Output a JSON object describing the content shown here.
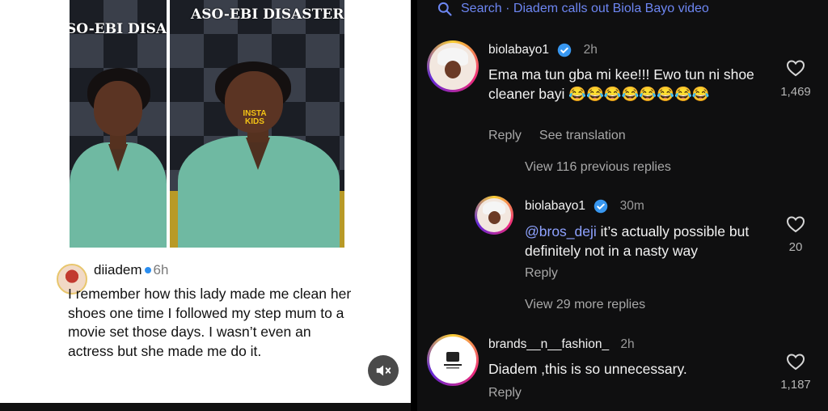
{
  "left_panel": {
    "frame1_title": "SO-EBI DISAS",
    "frame2_title": "ASO-EBI DISASTER",
    "sticker_text": "INSTA KIDS",
    "caption": {
      "username": "diiadem",
      "time": "6h",
      "text": "I remember how this lady made me clean her shoes one time I followed my step mum to a movie set those days. I wasn’t even an actress but she made me do it."
    },
    "mute_icon": "speaker-muted-icon"
  },
  "right_panel": {
    "search": {
      "icon": "search-icon",
      "text": "Search · Diadem calls out Biola Bayo video"
    },
    "comments": [
      {
        "username": "biolabayo1",
        "time": "2h",
        "text": "Ema ma tun gba mi kee!!! Ewo tun ni shoe cleaner bayi 😂😂😂😂😂😂😂😂",
        "reply_label": "Reply",
        "translation_label": "See translation",
        "likes": "1,469"
      },
      {
        "username": "biolabayo1",
        "time": "30m",
        "mention": "@bros_deji",
        "text": " it’s actually possible but definitely not in a nasty way",
        "reply_label": "Reply",
        "likes": "20"
      },
      {
        "username": "brands__n__fashion_",
        "time": "2h",
        "text": "Diadem ,this is so unnecessary.",
        "reply_label": "Reply",
        "likes": "1,187"
      }
    ],
    "view_previous_replies": "View 116 previous replies",
    "view_more_replies": "View 29 more replies",
    "colors": {
      "link": "#6d86f2",
      "verified": "#3897f0",
      "background": "#0f0f10"
    }
  }
}
